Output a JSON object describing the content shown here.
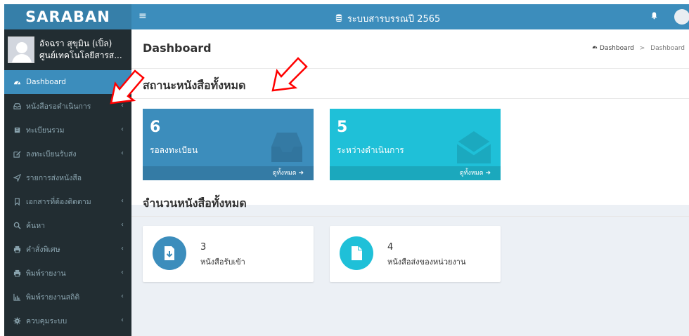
{
  "sidebar": {
    "logo": "SARABAN",
    "user_name": "อัจฉรา สุขุมิน (เปิ้ล)",
    "user_org": "ศูนย์เทคโนโลยีสารส...",
    "items": [
      {
        "label": "Dashboard",
        "icon": "dashboard-icon",
        "active": true,
        "chevron": false
      },
      {
        "label": "หนังสือรอดำเนินการ",
        "icon": "inbox-icon",
        "active": false,
        "chevron": true
      },
      {
        "label": "ทะเบียนรวม",
        "icon": "book-icon",
        "active": false,
        "chevron": true
      },
      {
        "label": "ลงทะเบียนรับส่ง",
        "icon": "edit-icon",
        "active": false,
        "chevron": true
      },
      {
        "label": "รายการส่งหนังสือ",
        "icon": "send-icon",
        "active": false,
        "chevron": false
      },
      {
        "label": "เอกสารที่ต้องติดตาม",
        "icon": "bookmark-icon",
        "active": false,
        "chevron": true
      },
      {
        "label": "ค้นหา",
        "icon": "search-icon",
        "active": false,
        "chevron": true
      },
      {
        "label": "คำสั่งพิเศษ",
        "icon": "print-icon",
        "active": false,
        "chevron": true
      },
      {
        "label": "พิมพ์รายงาน",
        "icon": "print-icon",
        "active": false,
        "chevron": true
      },
      {
        "label": "พิมพ์รายงานสถิติ",
        "icon": "bar-chart-icon",
        "active": false,
        "chevron": true
      },
      {
        "label": "ควบคุมระบบ",
        "icon": "gear-icon",
        "active": false,
        "chevron": true
      }
    ],
    "chevron_glyph": "‹"
  },
  "header": {
    "menu_glyph": "≡",
    "title": "ระบบสารบรรณปี 2565"
  },
  "content": {
    "page_title": "Dashboard",
    "breadcrumb": [
      "Dashboard",
      "Dashboard"
    ],
    "section1_title": "สถานะหนังสือทั้งหมด",
    "section2_title": "จำนวนหนังสือทั้งหมด",
    "cards": [
      {
        "count": "6",
        "label": "รอลงทะเบียน",
        "footer": "ดูทั้งหมด ➔",
        "color": "#3c8dbc"
      },
      {
        "count": "5",
        "label": "ระหว่างดำเนินการ",
        "footer": "ดูทั้งหมด ➔",
        "color": "#1fc0d8"
      }
    ],
    "infoboxes": [
      {
        "count": "3",
        "label": "หนังสือรับเข้า",
        "color": "#3c8dbc"
      },
      {
        "count": "4",
        "label": "หนังสือส่งของหน่วยงาน",
        "color": "#1fc0d8"
      }
    ]
  },
  "colors": {
    "header": "#3c8dbc",
    "logo_bar": "#367fa9",
    "sidebar": "#222d32",
    "active": "#3c8dbc",
    "teal": "#1fc0d8",
    "annotation_arrow": "#ff0000"
  }
}
